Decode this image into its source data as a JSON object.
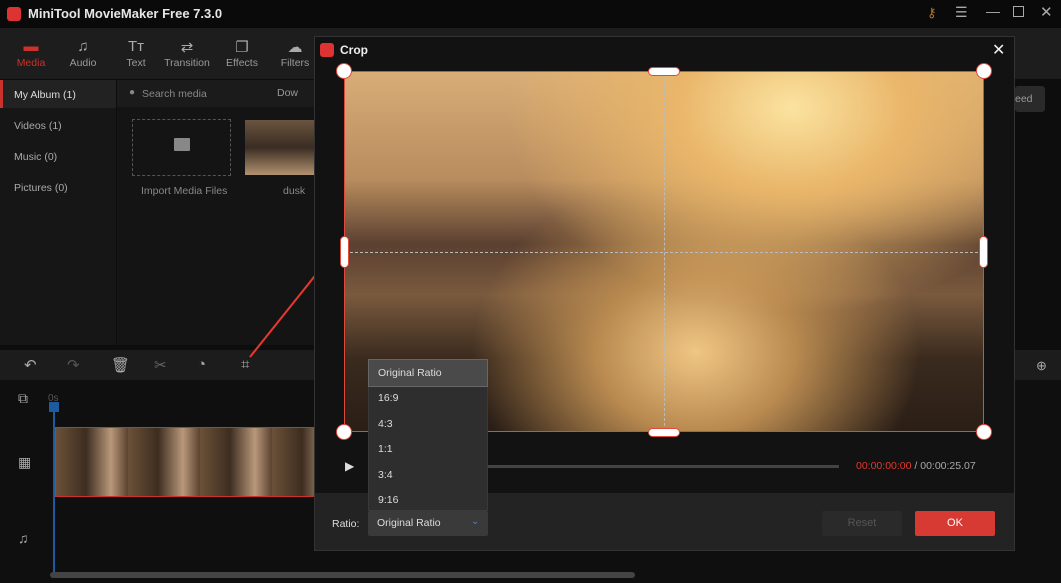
{
  "app": {
    "title": "MiniTool MovieMaker Free 7.3.0"
  },
  "toolbar": [
    {
      "label": "Media",
      "icon": "folder-icon",
      "active": true
    },
    {
      "label": "Audio",
      "icon": "music-icon"
    },
    {
      "label": "Text",
      "icon": "text-icon"
    },
    {
      "label": "Transition",
      "icon": "transition-icon"
    },
    {
      "label": "Effects",
      "icon": "effects-icon"
    },
    {
      "label": "Filters",
      "icon": "filters-icon"
    }
  ],
  "sidebar": [
    {
      "label": "My Album (1)",
      "selected": true
    },
    {
      "label": "Videos (1)"
    },
    {
      "label": "Music (0)"
    },
    {
      "label": "Pictures (0)"
    }
  ],
  "media": {
    "search_placeholder": "Search media",
    "download_label": "Dow",
    "import_label": "Import Media Files",
    "clip_label": "dusk"
  },
  "right_panel": {
    "button_fragment": "eed"
  },
  "timeline": {
    "ruler_start": "0s"
  },
  "dialog": {
    "title": "Crop",
    "current_time": "00:00:00:00",
    "separator": " / ",
    "total_time": "00:00:25.07",
    "ratio_label": "Ratio:",
    "ratio_value": "Original Ratio",
    "reset_label": "Reset",
    "ok_label": "OK",
    "ratio_options": [
      "Original Ratio",
      "16:9",
      "4:3",
      "1:1",
      "3:4",
      "9:16"
    ]
  },
  "colors": {
    "accent": "#c9332b",
    "ok": "#d63a32",
    "time_current": "#e0392f"
  }
}
